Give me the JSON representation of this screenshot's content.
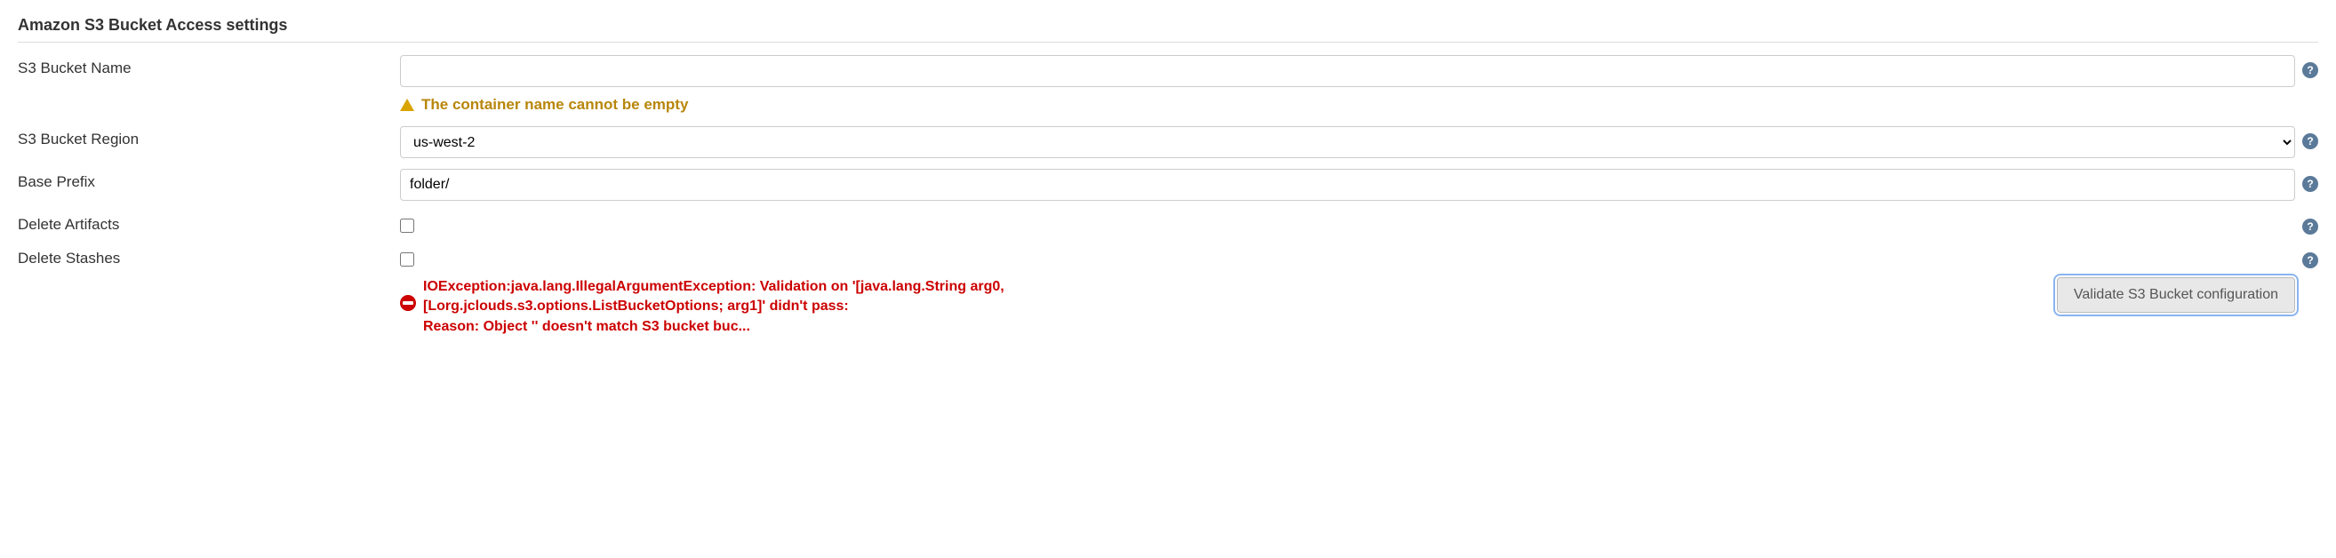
{
  "section": {
    "title": "Amazon S3 Bucket Access settings"
  },
  "fields": {
    "bucket_name": {
      "label": "S3 Bucket Name",
      "value": "",
      "warning": "The container name cannot be empty"
    },
    "bucket_region": {
      "label": "S3 Bucket Region",
      "value": "us-west-2"
    },
    "base_prefix": {
      "label": "Base Prefix",
      "value": "folder/"
    },
    "delete_artifacts": {
      "label": "Delete Artifacts"
    },
    "delete_stashes": {
      "label": "Delete Stashes"
    }
  },
  "error": {
    "message": "IOException:java.lang.IllegalArgumentException: Validation on '[java.lang.String arg0, [Lorg.jclouds.s3.options.ListBucketOptions; arg1]' didn't pass:\nReason: Object '' doesn't match S3 bucket buc..."
  },
  "validate_button": {
    "label": "Validate S3 Bucket configuration"
  }
}
